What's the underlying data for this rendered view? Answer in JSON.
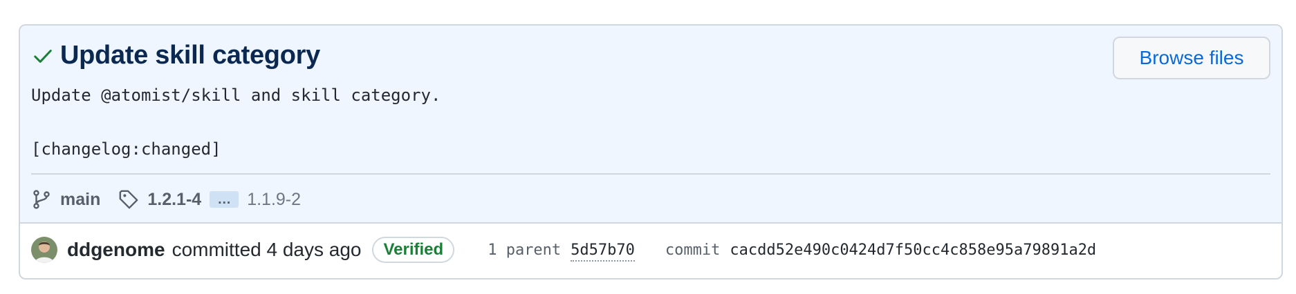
{
  "commit": {
    "title": "Update skill category",
    "message_lines": [
      "Update @atomist/skill and skill category.",
      "",
      "[changelog:changed]"
    ],
    "browse_files_label": "Browse files",
    "branch": "main",
    "tag_primary": "1.2.1-4",
    "tags_more_label": "…",
    "tag_secondary": "1.1.9-2",
    "author": "ddgenome",
    "committed_text": "committed 4 days ago",
    "verified_label": "Verified",
    "parent_label": "1 parent",
    "parent_sha": "5d57b70",
    "commit_label": "commit",
    "commit_sha": "cacdd52e490c0424d7f50cc4c858e95a79891a2d"
  },
  "colors": {
    "header_background": "#eff6ff",
    "title_color": "#0b2950",
    "check_color": "#1a7f37",
    "link_blue": "#0969da",
    "verified_green": "#1a7f37"
  },
  "icons": {
    "status": "check-icon",
    "branch": "git-branch-icon",
    "tag": "tag-icon",
    "avatar": "user-avatar"
  }
}
